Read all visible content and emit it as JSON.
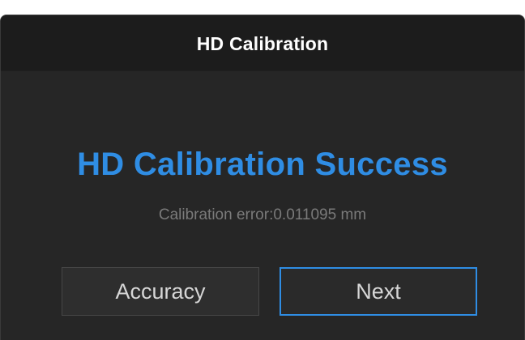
{
  "dialog": {
    "title": "HD Calibration",
    "headline": "HD Calibration Success",
    "error_text": "Calibration error:0.011095 mm",
    "buttons": {
      "accuracy_label": "Accuracy",
      "next_label": "Next"
    }
  },
  "colors": {
    "accent": "#2f8de4",
    "dialog_bg": "#262626",
    "titlebar_bg": "#1c1c1c",
    "muted_text": "#7a7a7a"
  }
}
